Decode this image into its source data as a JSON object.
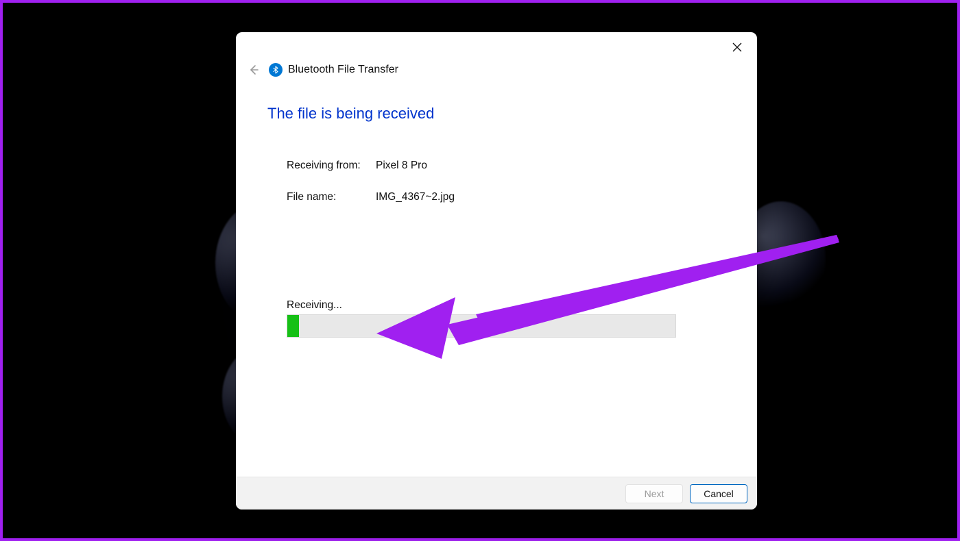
{
  "dialog": {
    "title": "Bluetooth File Transfer",
    "heading": "The file is being received",
    "receivingFromLabel": "Receiving from:",
    "receivingFromValue": "Pixel 8 Pro",
    "fileNameLabel": "File name:",
    "fileNameValue": "IMG_4367~2.jpg",
    "progressLabel": "Receiving...",
    "progressPercent": 3,
    "buttons": {
      "next": "Next",
      "cancel": "Cancel"
    }
  },
  "annotation": {
    "arrowColor": "#a020f0"
  }
}
